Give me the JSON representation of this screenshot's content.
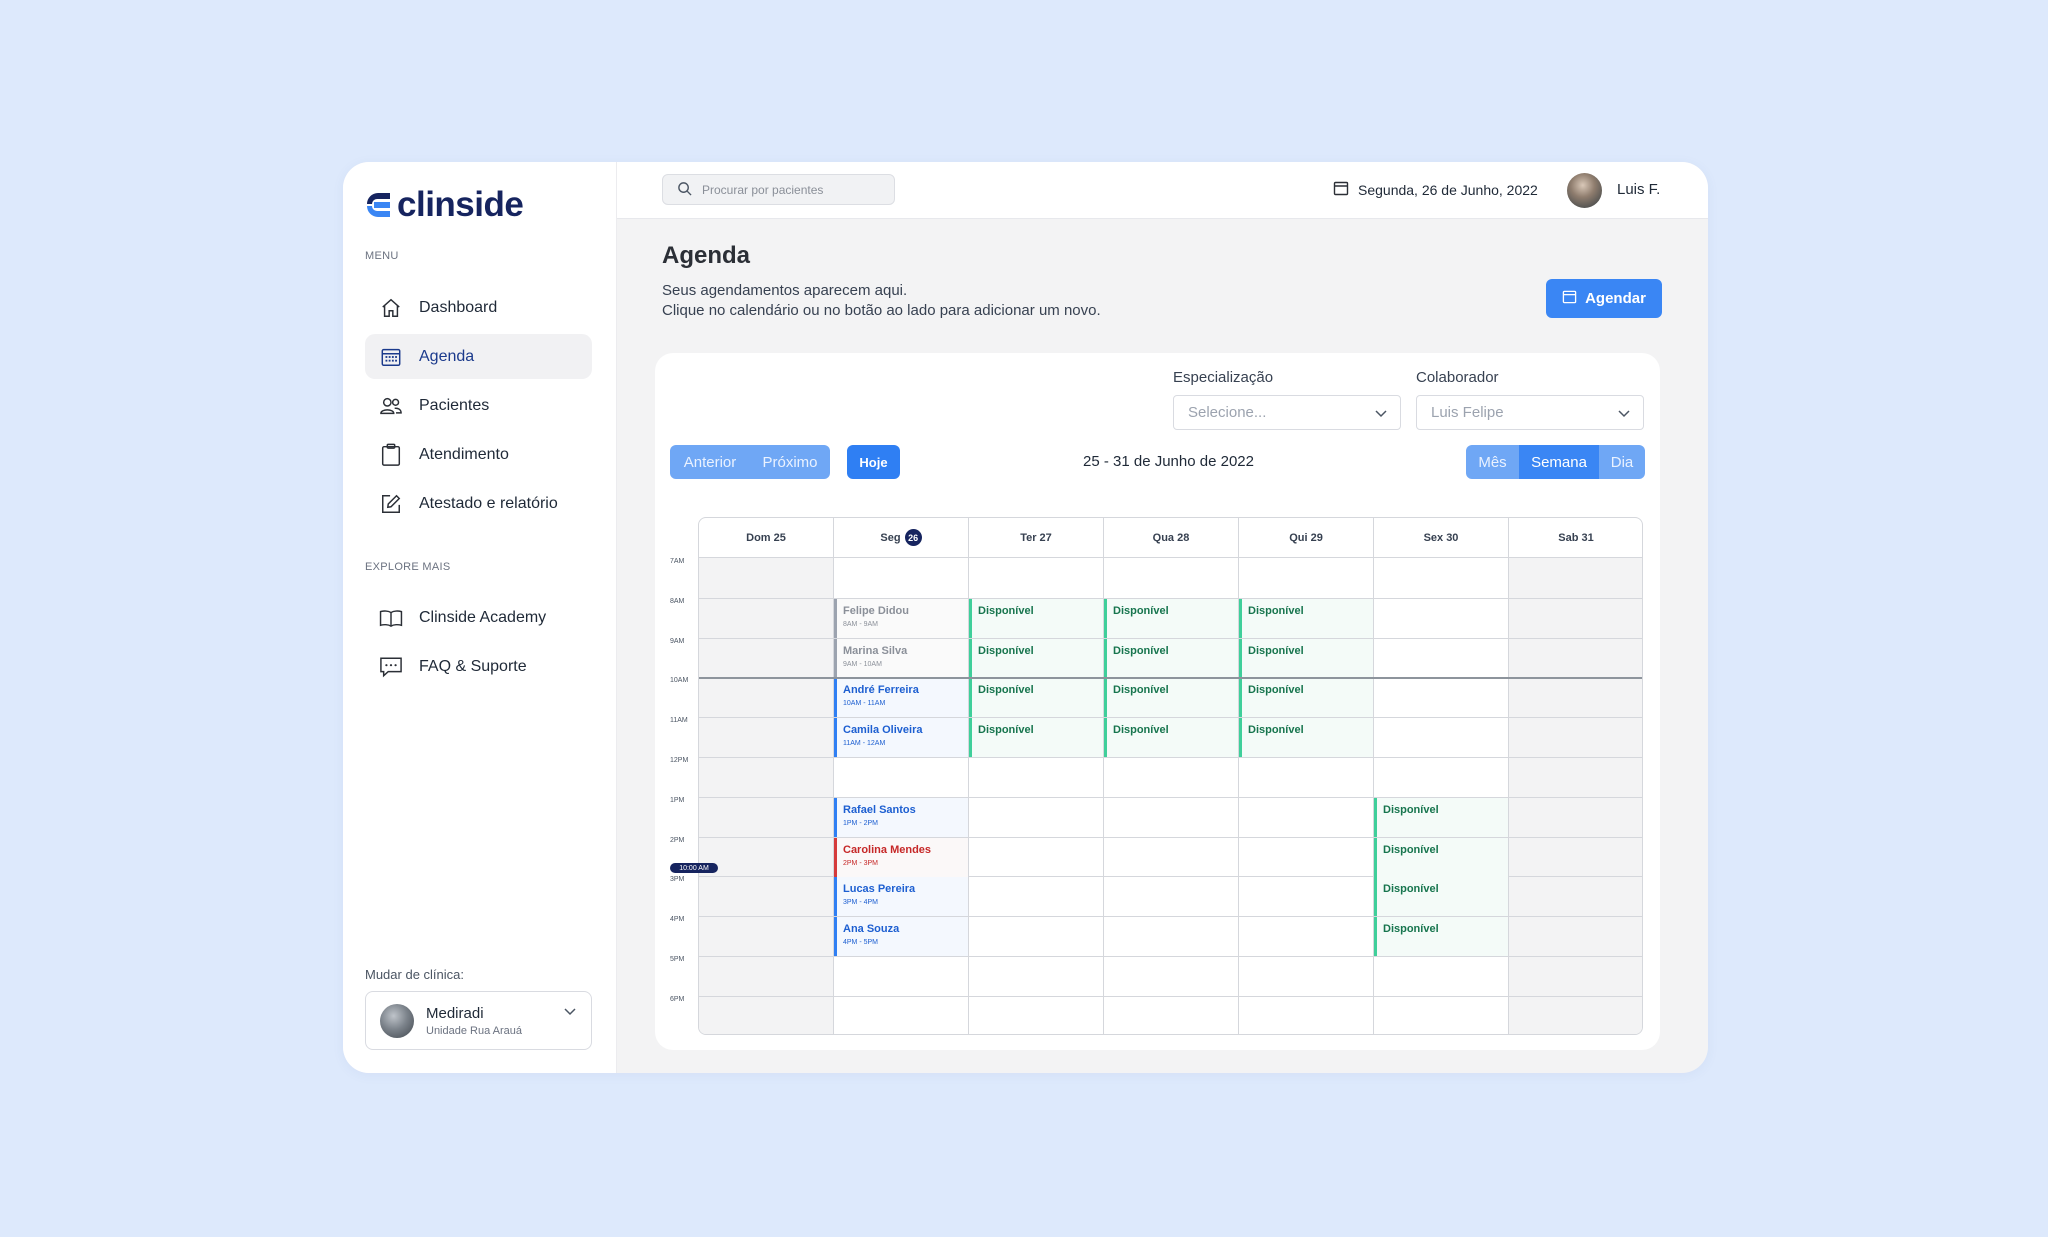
{
  "brand": {
    "name": "clinside",
    "color": "#16245f",
    "accent": "#3a86f4"
  },
  "sidebar": {
    "menu_title": "MENU",
    "items": [
      {
        "label": "Dashboard",
        "icon": "home-icon",
        "active": false
      },
      {
        "label": "Agenda",
        "icon": "calendar-grid-icon",
        "active": true
      },
      {
        "label": "Pacientes",
        "icon": "users-icon",
        "active": false
      },
      {
        "label": "Atendimento",
        "icon": "clipboard-icon",
        "active": false
      },
      {
        "label": "Atestado e relatório",
        "icon": "edit-icon",
        "active": false
      }
    ],
    "explore_title": "EXPLORE MAIS",
    "explore_items": [
      {
        "label": "Clinside Academy",
        "icon": "book-icon"
      },
      {
        "label": "FAQ & Suporte",
        "icon": "chat-icon"
      }
    ],
    "clinic_label": "Mudar de clínica:",
    "clinic": {
      "name": "Mediradi",
      "unit": "Unidade Rua Arauá"
    }
  },
  "topbar": {
    "search_placeholder": "Procurar por pacientes",
    "date": "Segunda, 26 de Junho, 2022",
    "user_name": "Luis F."
  },
  "page": {
    "title": "Agenda",
    "subtitle_line1": "Seus agendamentos aparecem aqui.",
    "subtitle_line2": "Clique no calendário ou no botão ao lado para adicionar um novo.",
    "cta_label": "Agendar"
  },
  "filters": {
    "specialization_label": "Especialização",
    "specialization_value": "Selecione...",
    "collaborator_label": "Colaborador",
    "collaborator_value": "Luis Felipe"
  },
  "nav": {
    "prev": "Anterior",
    "next": "Próximo",
    "today": "Hoje",
    "range": "25 - 31 de Junho de 2022",
    "views": [
      {
        "label": "Mês",
        "active": false
      },
      {
        "label": "Semana",
        "active": true
      },
      {
        "label": "Dia",
        "active": false
      }
    ]
  },
  "calendar": {
    "days": [
      {
        "label": "Dom 25",
        "name": "Dom",
        "num": "25",
        "today": false,
        "gray": true
      },
      {
        "label": "Seg 26",
        "name": "Seg",
        "num": "26",
        "today": true,
        "gray": false
      },
      {
        "label": "Ter 27",
        "name": "Ter",
        "num": "27",
        "today": false,
        "gray": false
      },
      {
        "label": "Qua 28",
        "name": "Qua",
        "num": "28",
        "today": false,
        "gray": false
      },
      {
        "label": "Qui 29",
        "name": "Qui",
        "num": "29",
        "today": false,
        "gray": false
      },
      {
        "label": "Sex 30",
        "name": "Sex",
        "num": "30",
        "today": false,
        "gray": false
      },
      {
        "label": "Sab 31",
        "name": "Sab",
        "num": "31",
        "today": false,
        "gray": true
      }
    ],
    "hours": [
      "7AM",
      "8AM",
      "9AM",
      "10AM",
      "11AM",
      "12PM",
      "1PM",
      "2PM",
      "3PM",
      "4PM",
      "5PM",
      "6PM"
    ],
    "now_label": "10:00 AM",
    "now_hour": 10,
    "events": [
      {
        "day": 1,
        "start": 8,
        "title": "Felipe Didou",
        "time": "8AM - 9AM",
        "style": "gray"
      },
      {
        "day": 1,
        "start": 9,
        "title": "Marina Silva",
        "time": "9AM - 10AM",
        "style": "gray"
      },
      {
        "day": 1,
        "start": 10,
        "title": "André Ferreira",
        "time": "10AM - 11AM",
        "style": "blue"
      },
      {
        "day": 1,
        "start": 11,
        "title": "Camila Oliveira",
        "time": "11AM - 12AM",
        "style": "blue"
      },
      {
        "day": 1,
        "start": 13,
        "title": "Rafael Santos",
        "time": "1PM - 2PM",
        "style": "blue"
      },
      {
        "day": 1,
        "start": 14,
        "title": "Carolina Mendes",
        "time": "2PM - 3PM",
        "style": "red"
      },
      {
        "day": 1,
        "start": 15,
        "title": "Lucas Pereira",
        "time": "3PM - 4PM",
        "style": "blue"
      },
      {
        "day": 1,
        "start": 16,
        "title": "Ana Souza",
        "time": "4PM - 5PM",
        "style": "blue"
      },
      {
        "day": 2,
        "start": 8,
        "title": "Disponível",
        "style": "green"
      },
      {
        "day": 2,
        "start": 9,
        "title": "Disponível",
        "style": "green"
      },
      {
        "day": 2,
        "start": 10,
        "title": "Disponível",
        "style": "green"
      },
      {
        "day": 2,
        "start": 11,
        "title": "Disponível",
        "style": "green"
      },
      {
        "day": 3,
        "start": 8,
        "title": "Disponível",
        "style": "green"
      },
      {
        "day": 3,
        "start": 9,
        "title": "Disponível",
        "style": "green"
      },
      {
        "day": 3,
        "start": 10,
        "title": "Disponível",
        "style": "green"
      },
      {
        "day": 3,
        "start": 11,
        "title": "Disponível",
        "style": "green"
      },
      {
        "day": 4,
        "start": 8,
        "title": "Disponível",
        "style": "green"
      },
      {
        "day": 4,
        "start": 9,
        "title": "Disponível",
        "style": "green"
      },
      {
        "day": 4,
        "start": 10,
        "title": "Disponível",
        "style": "green"
      },
      {
        "day": 4,
        "start": 11,
        "title": "Disponível",
        "style": "green"
      },
      {
        "day": 5,
        "start": 13,
        "title": "Disponível",
        "style": "green"
      },
      {
        "day": 5,
        "start": 14,
        "title": "Disponível",
        "style": "green"
      },
      {
        "day": 5,
        "start": 15,
        "title": "Disponível",
        "style": "green"
      },
      {
        "day": 5,
        "start": 16,
        "title": "Disponível",
        "style": "green"
      }
    ]
  }
}
